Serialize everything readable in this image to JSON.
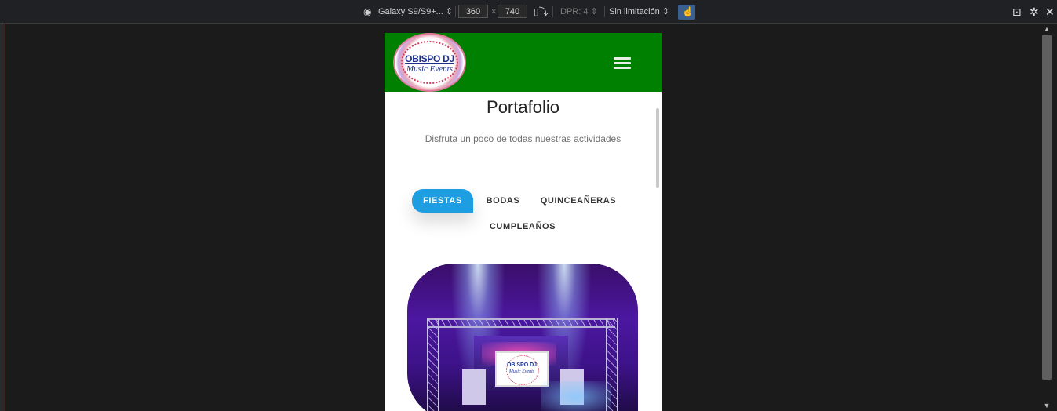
{
  "devtools": {
    "device_name": "Galaxy S9/S9+...",
    "width": "360",
    "times": "×",
    "height": "740",
    "dpr": "DPR: 4",
    "throttle": "Sin limitación",
    "icons": [
      "chrome-icon",
      "rotate-icon",
      "touch-icon",
      "screenshot-icon",
      "settings-icon",
      "close-icon"
    ]
  },
  "site": {
    "logo_line1": "OBISPO DJ",
    "logo_line2": "Music Events",
    "title": "Portafolio",
    "subtitle": "Disfruta un poco de todas nuestras actividades",
    "tabs": [
      {
        "label": "FIESTAS",
        "active": true
      },
      {
        "label": "BODAS",
        "active": false
      },
      {
        "label": "QUINCEAÑERAS",
        "active": false
      },
      {
        "label": "CUMPLEAÑOS",
        "active": false
      }
    ],
    "header_color": "#008000",
    "accent_color": "#1e9ee0"
  }
}
